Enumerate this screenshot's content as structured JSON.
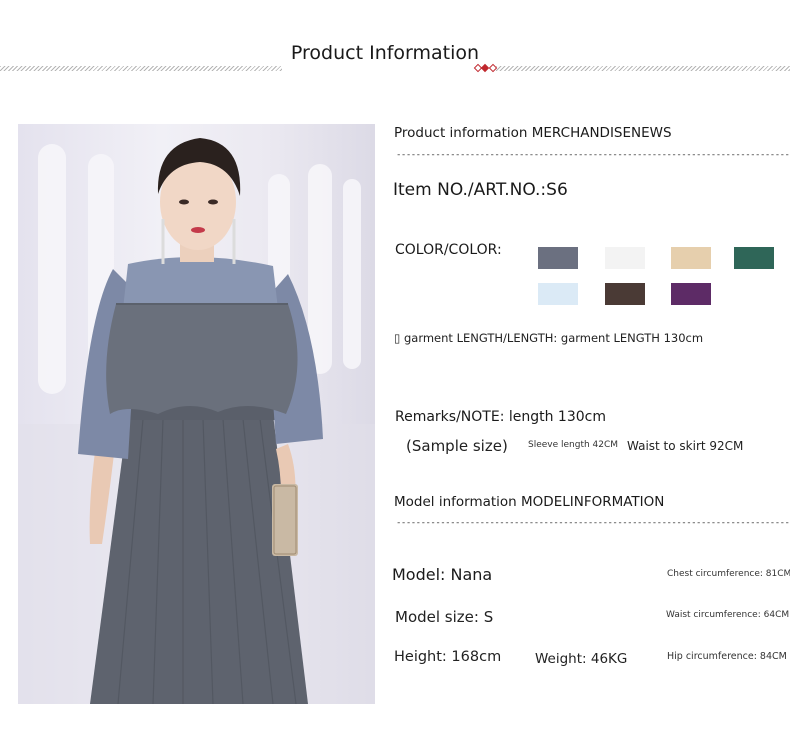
{
  "page_title": "Product Information",
  "product": {
    "section_header": "Product information MERCHANDISENEWS",
    "divider": "-------------------------------------------------------------------------------------",
    "item_no": "Item NO./ART.NO.:S6",
    "color_label": "COLOR/COLOR:",
    "colors": [
      "#6b7080",
      "#f3f3f3",
      "#e6cfad",
      "#2f6658",
      "#dbeaf6",
      "#4a3a35",
      "#5d2b66"
    ],
    "length": "▯ garment LENGTH/LENGTH: garment LENGTH 130cm",
    "remarks": "Remarks/NOTE: length 130cm",
    "sample_size": "(Sample size)",
    "sleeve": "Sleeve length 42CM",
    "waist_to_skirt": "Waist to skirt 92CM"
  },
  "model": {
    "section_header": "Model information MODELINFORMATION",
    "divider": "-------------------------------------------------------------------------------------",
    "name": "Model: Nana",
    "size": "Model size: S",
    "height": "Height: 168cm",
    "weight": "Weight: 46KG",
    "chest": "Chest circumference: 81CM",
    "waist": "Waist circumference: 64CM",
    "hip": "Hip circumference: 84CM"
  }
}
